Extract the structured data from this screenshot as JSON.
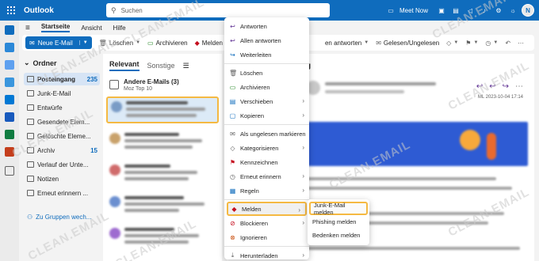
{
  "app": {
    "title": "Outlook"
  },
  "search": {
    "placeholder": "Suchen"
  },
  "topbar": {
    "meet_now": "Meet Now",
    "avatar_initials": "N"
  },
  "ribbon": {
    "tabs": [
      "Startseite",
      "Ansicht",
      "Hilfe"
    ],
    "commands": {
      "new_mail": "Neue E-Mail",
      "delete": "Löschen",
      "archive": "Archivieren",
      "report": "Melden",
      "reply_all": "en antworten",
      "read_unread": "Gelesen/Ungelesen"
    }
  },
  "folders": {
    "header": "Ordner",
    "items": [
      {
        "label": "Posteingang",
        "count": "235"
      },
      {
        "label": "Junk-E-Mail",
        "count": ""
      },
      {
        "label": "Entwürfe",
        "count": ""
      },
      {
        "label": "Gesendete Elem...",
        "count": ""
      },
      {
        "label": "Gelöschte Eleme...",
        "count": ""
      },
      {
        "label": "Archiv",
        "count": "15"
      },
      {
        "label": "Verlauf der Unte...",
        "count": ""
      },
      {
        "label": "Notizen",
        "count": ""
      },
      {
        "label": "Erneut erinnern ...",
        "count": ""
      }
    ],
    "add_group": "Zu Gruppen wech..."
  },
  "message_list": {
    "tab_focused": "Relevant",
    "tab_other": "Sonstige",
    "other_mails_title": "Andere E-Mails (3)",
    "other_mails_sub": "Moz Top 10"
  },
  "reading_pane": {
    "subject_fragment": "g",
    "date": "ML 2023-10-04 17:14"
  },
  "context_menu": {
    "items": [
      {
        "label": "Antworten",
        "icon": "reply-icon"
      },
      {
        "label": "Allen antworten",
        "icon": "reply-all-icon"
      },
      {
        "label": "Weiterleiten",
        "icon": "forward-icon"
      },
      {
        "label": "Löschen",
        "icon": "trash-icon"
      },
      {
        "label": "Archivieren",
        "icon": "archive-icon"
      },
      {
        "label": "Verschieben",
        "icon": "move-icon"
      },
      {
        "label": "Kopieren",
        "icon": "copy-icon"
      },
      {
        "label": "Als ungelesen markieren",
        "icon": "mark-unread-icon"
      },
      {
        "label": "Kategorisieren",
        "icon": "tag-icon"
      },
      {
        "label": "Kennzeichnen",
        "icon": "flag-icon"
      },
      {
        "label": "Erneut erinnern",
        "icon": "clock-icon"
      },
      {
        "label": "Regeln",
        "icon": "rules-icon"
      },
      {
        "label": "Melden",
        "icon": "shield-icon"
      },
      {
        "label": "Blockieren",
        "icon": "block-icon"
      },
      {
        "label": "Ignorieren",
        "icon": "ignore-icon"
      },
      {
        "label": "Herunterladen",
        "icon": "download-icon"
      }
    ]
  },
  "report_submenu": {
    "items": [
      "Junk-E-Mail melden",
      "Phishing melden",
      "Bedenken melden"
    ]
  },
  "watermark": "CLEAN.EMAIL",
  "colors": {
    "brand": "#0f6cbd",
    "highlight": "#f5b942",
    "shield": "#c50f1f"
  }
}
